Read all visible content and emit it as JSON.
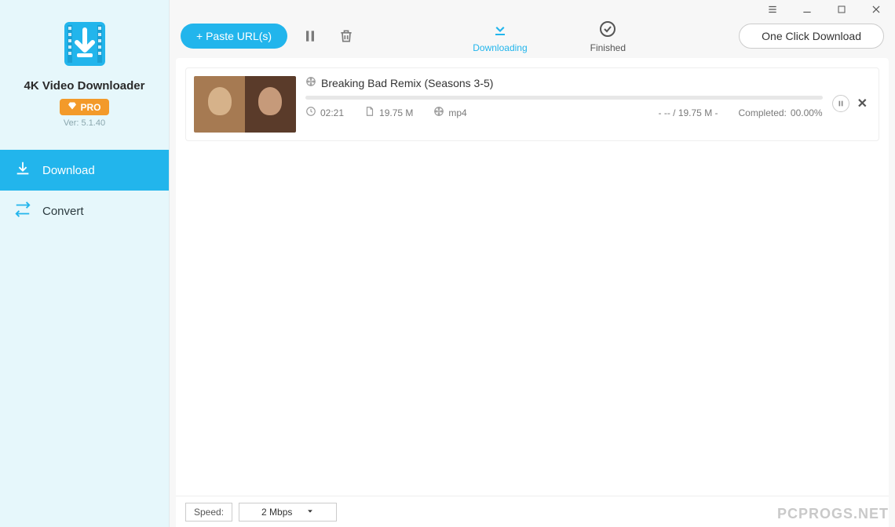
{
  "app": {
    "title": "4K Video Downloader",
    "pro_label": "PRO",
    "version": "Ver: 5.1.40"
  },
  "sidebar": {
    "items": [
      {
        "label": "Download"
      },
      {
        "label": "Convert"
      }
    ]
  },
  "toolbar": {
    "paste_label": "+ Paste URL(s)",
    "one_click_label": "One Click Download"
  },
  "tabs": {
    "downloading": "Downloading",
    "finished": "Finished"
  },
  "downloads": [
    {
      "title": "Breaking Bad Remix (Seasons 3-5)",
      "duration": "02:21",
      "size": "19.75 M",
      "format": "mp4",
      "transferred": "- -- / 19.75 M -",
      "completed_label": "Completed:",
      "completed_pct": "00.00%"
    }
  ],
  "footer": {
    "speed_label": "Speed:",
    "speed_value": "2 Mbps"
  },
  "watermark": "PCPROGS.NET"
}
